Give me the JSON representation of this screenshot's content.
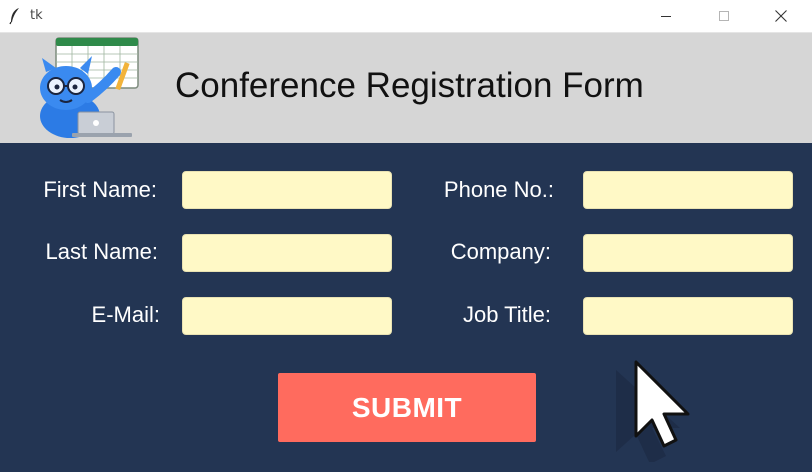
{
  "window": {
    "title": "tk",
    "controls": [
      "minimize",
      "maximize",
      "close"
    ]
  },
  "header": {
    "title": "Conference Registration Form",
    "mascot_icon": "spreadsheet-mascot-icon"
  },
  "form": {
    "left_fields": [
      {
        "label": "First Name:",
        "value": ""
      },
      {
        "label": "Last Name:",
        "value": ""
      },
      {
        "label": "E-Mail:",
        "value": ""
      }
    ],
    "right_fields": [
      {
        "label": "Phone No.:",
        "value": ""
      },
      {
        "label": "Company:",
        "value": ""
      },
      {
        "label": "Job Title:",
        "value": ""
      }
    ],
    "submit_label": "SUBMIT"
  },
  "colors": {
    "background": "#233553",
    "header": "#d6d6d6",
    "field": "#fff9c6",
    "submit": "#ff6b5e"
  }
}
